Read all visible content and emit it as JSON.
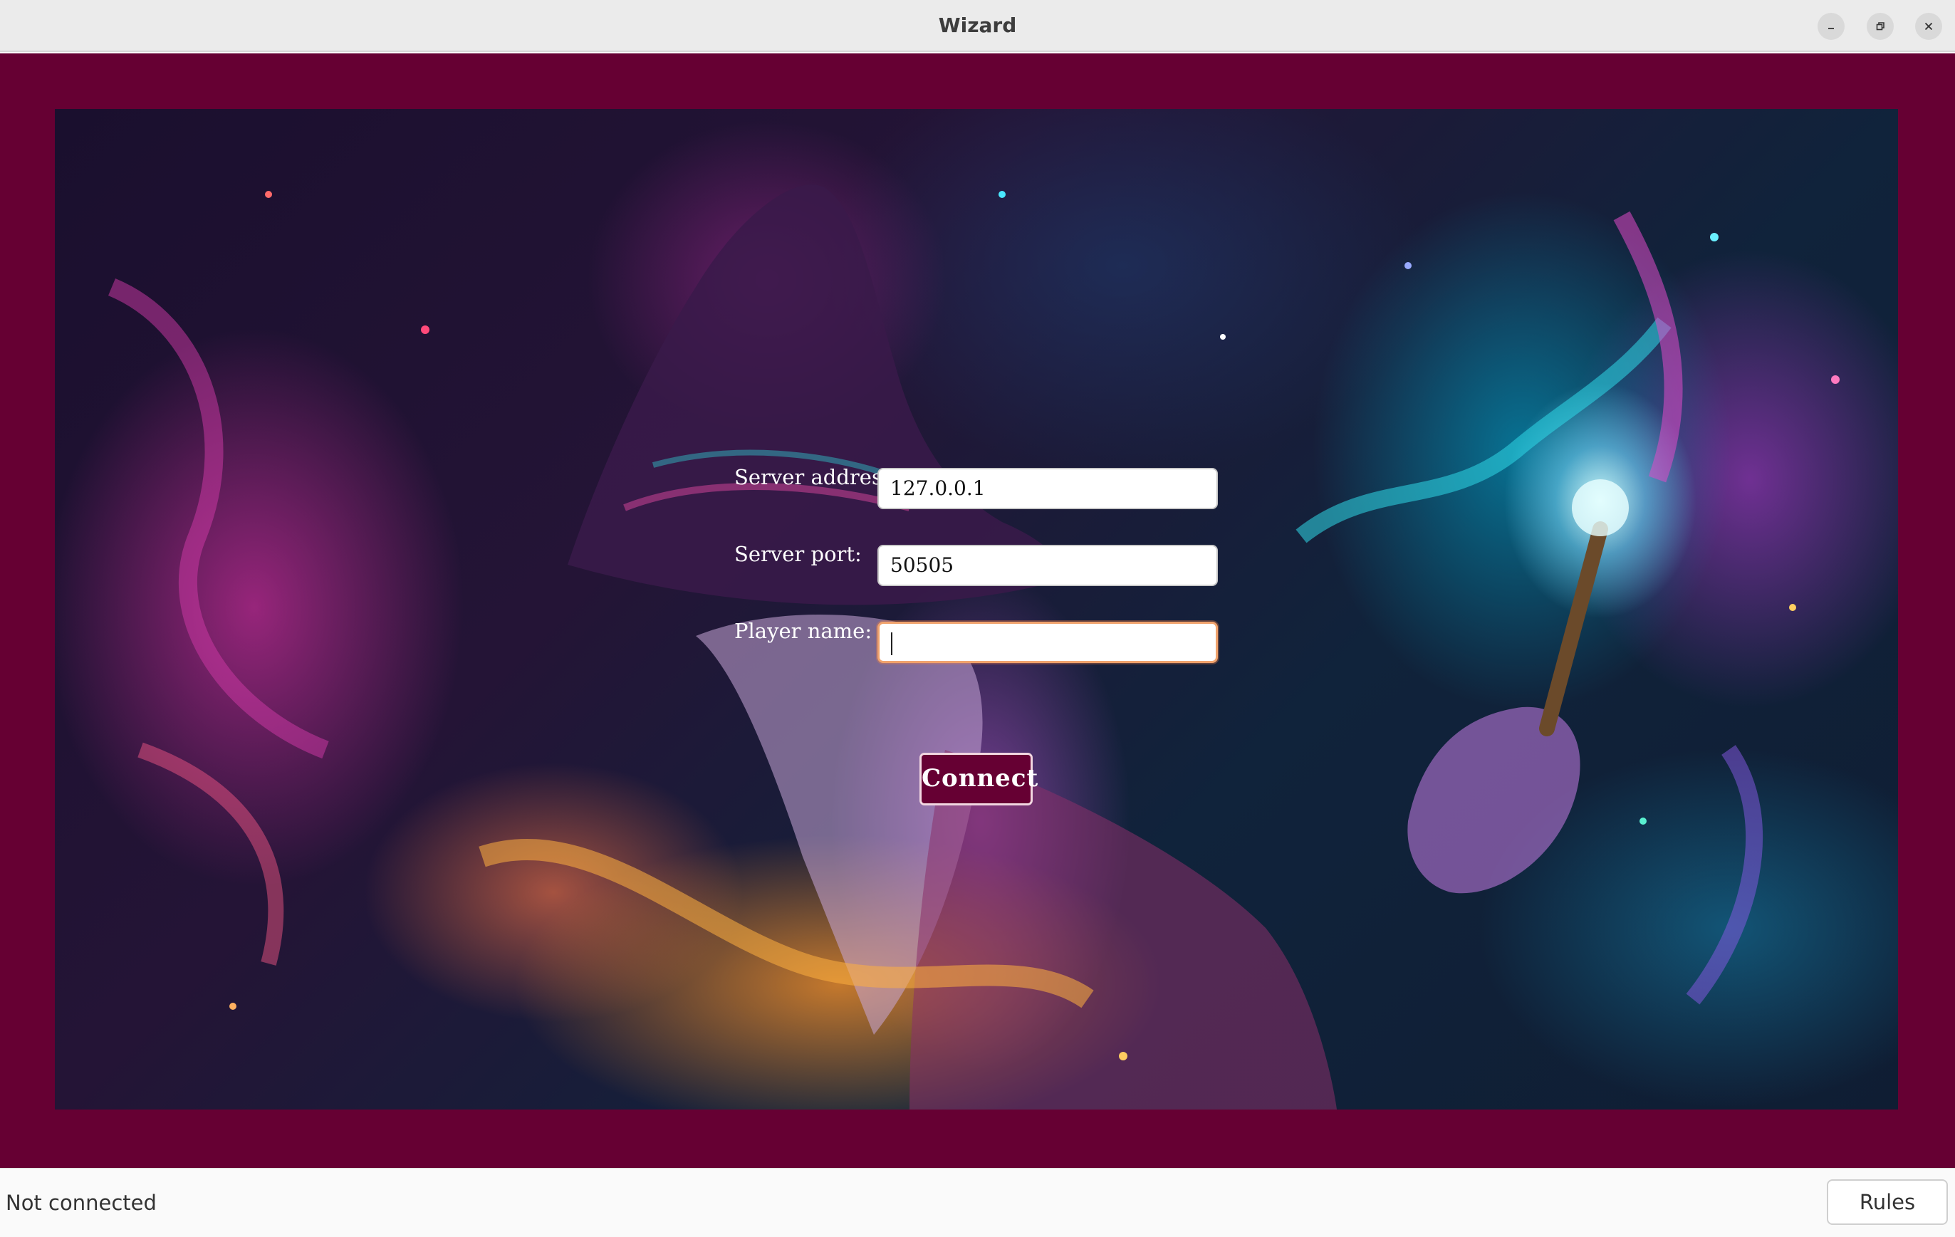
{
  "window": {
    "title": "Wizard"
  },
  "form": {
    "server_address": {
      "label": "Server address:",
      "value": "127.0.0.1"
    },
    "server_port": {
      "label": "Server port:",
      "value": "50505"
    },
    "player_name": {
      "label": "Player name:",
      "value": ""
    },
    "connect_label": "Connect"
  },
  "statusbar": {
    "status": "Not connected",
    "rules_label": "Rules"
  },
  "colors": {
    "background": "#660033",
    "button": "#660033",
    "focus_border": "#f0a36d"
  },
  "icons": {
    "minimize": "minimize-icon",
    "maximize": "restore-icon",
    "close": "close-icon"
  }
}
